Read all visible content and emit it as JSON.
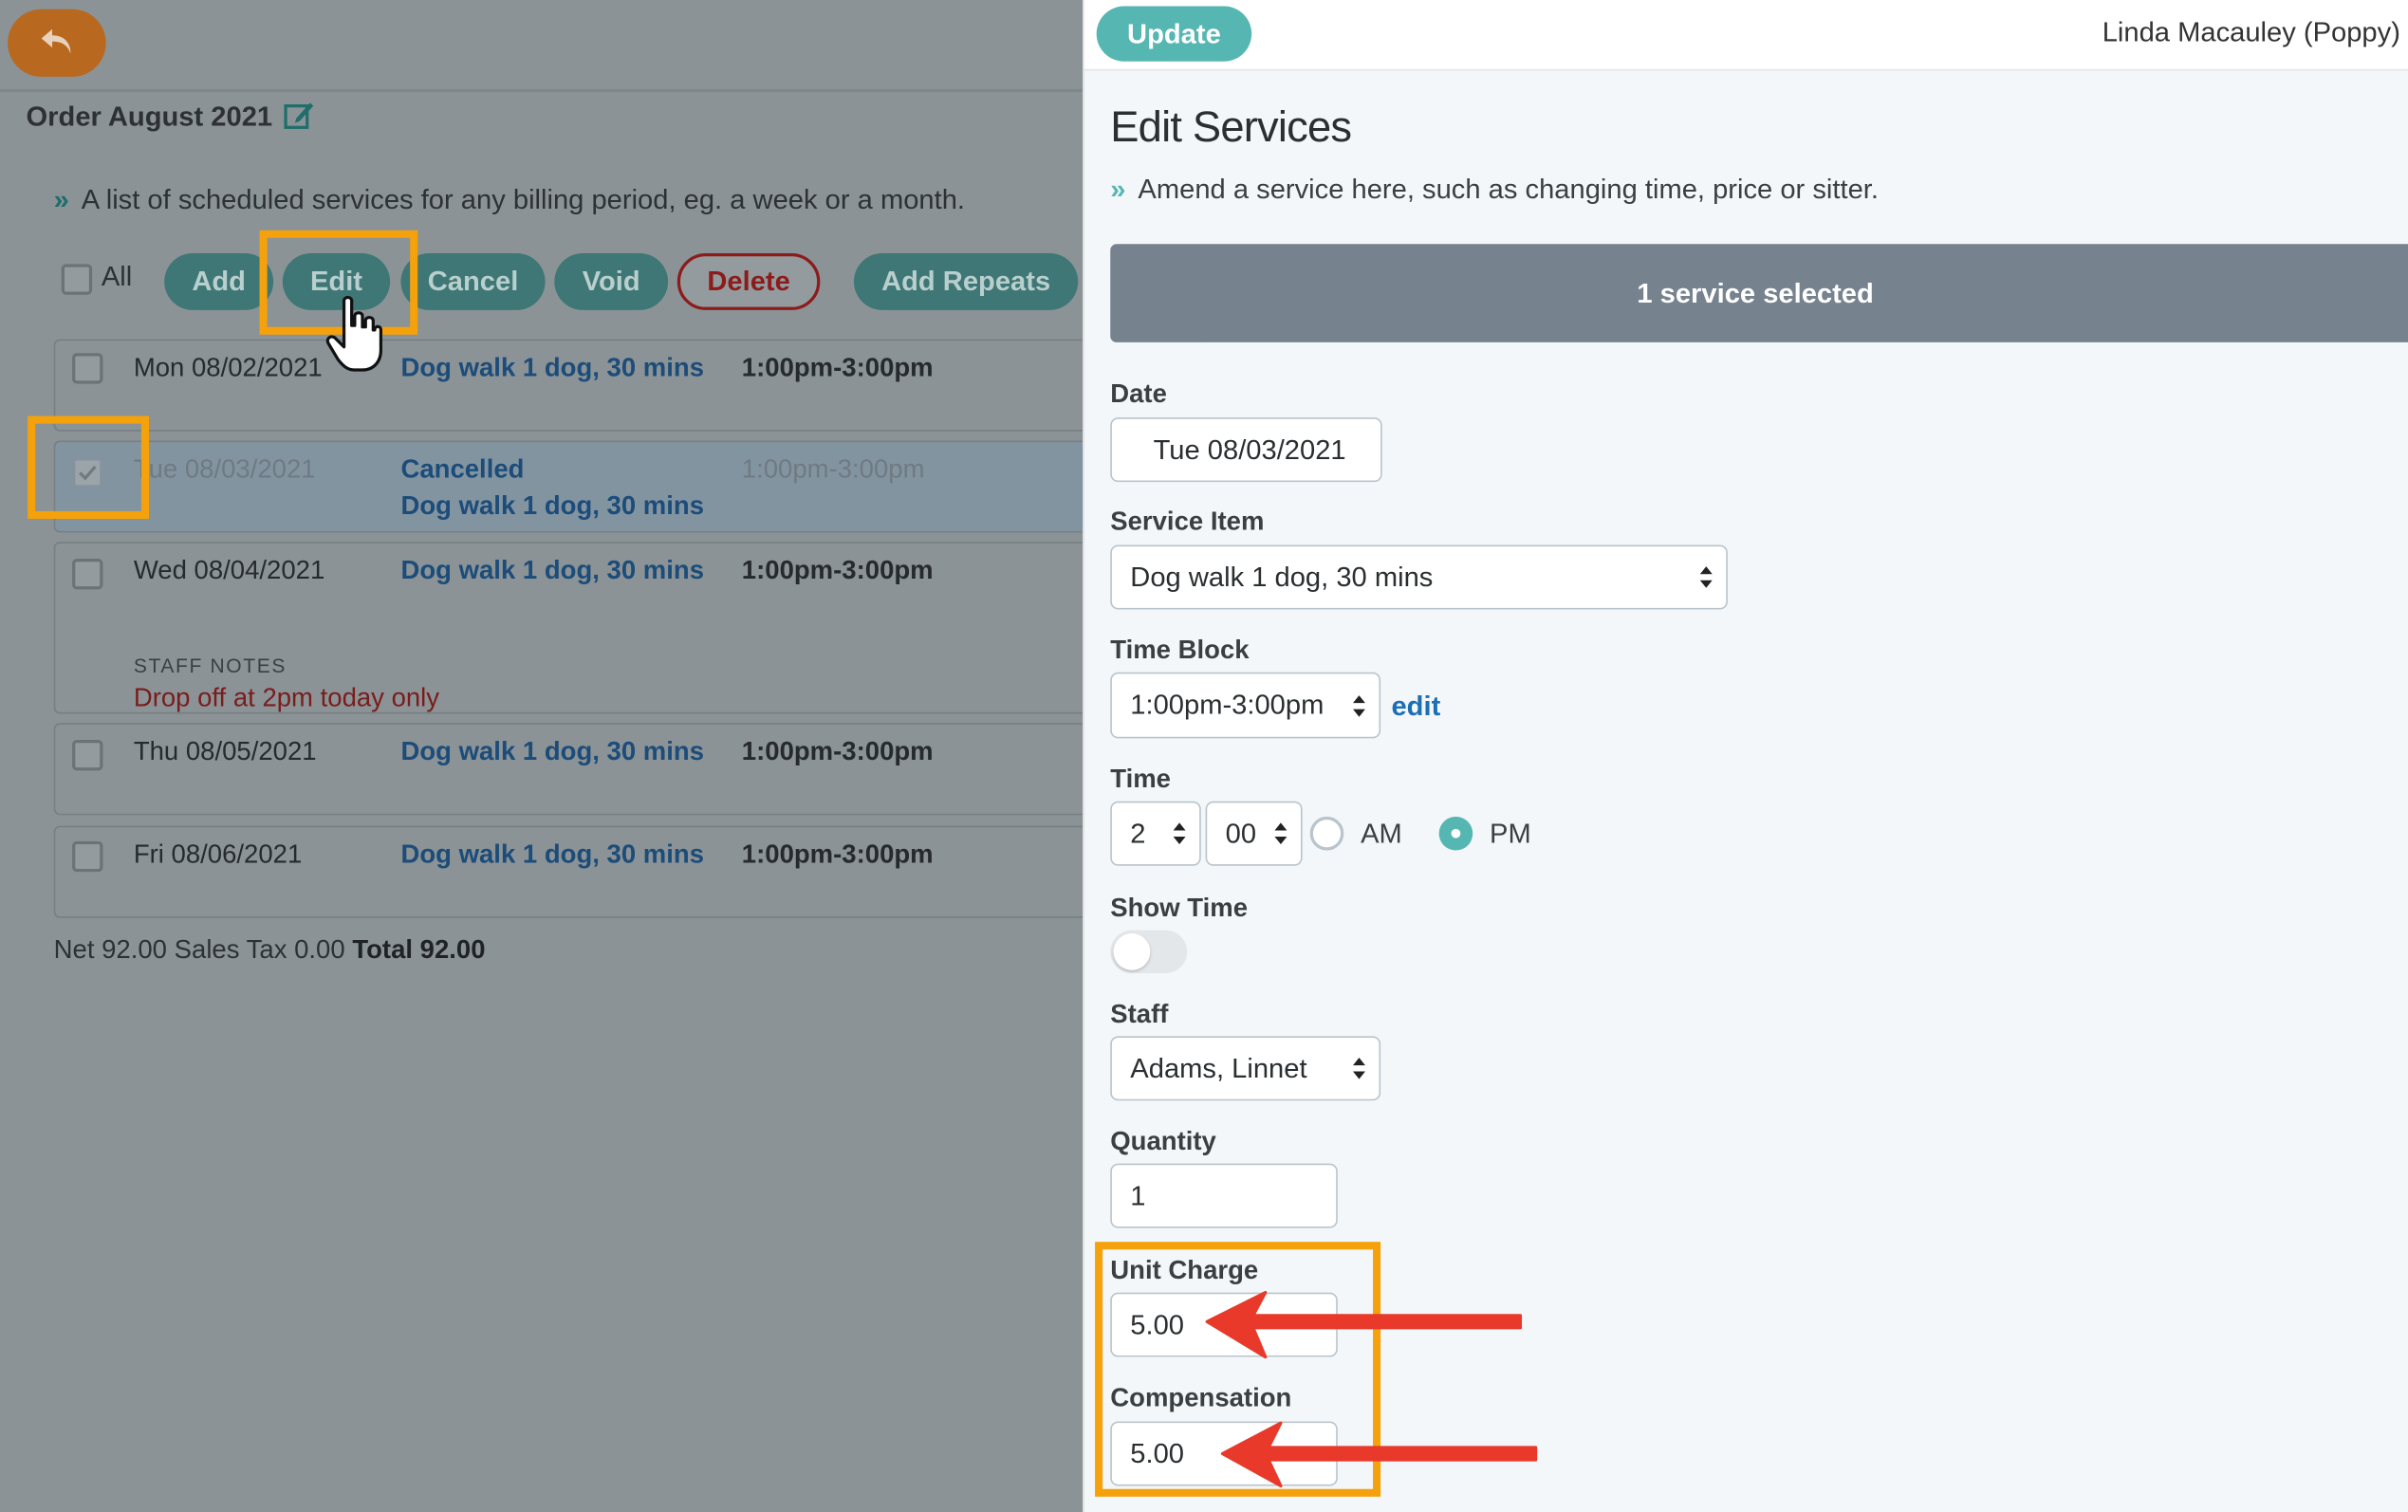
{
  "left": {
    "order_title": "Order August 2021",
    "intro": "A list of scheduled services for any billing period, eg. a week or a month.",
    "all_label": "All",
    "buttons": {
      "add": "Add",
      "edit": "Edit",
      "cancel": "Cancel",
      "void": "Void",
      "delete": "Delete",
      "add_repeats": "Add Repeats"
    },
    "rows": [
      {
        "date": "Mon 08/02/2021",
        "service": "Dog walk 1 dog, 30 mins",
        "time": "1:00pm-3:00pm"
      },
      {
        "date": "Tue 08/03/2021",
        "status": "Cancelled",
        "service": "Dog walk 1 dog, 30 mins",
        "time": "1:00pm-3:00pm",
        "checked": true
      },
      {
        "date": "Wed 08/04/2021",
        "service": "Dog walk 1 dog, 30 mins",
        "time": "1:00pm-3:00pm",
        "notes_heading": "STAFF NOTES",
        "notes": "Drop off at 2pm today only"
      },
      {
        "date": "Thu 08/05/2021",
        "service": "Dog walk 1 dog, 30 mins",
        "time": "1:00pm-3:00pm"
      },
      {
        "date": "Fri 08/06/2021",
        "service": "Dog walk 1 dog, 30 mins",
        "time": "1:00pm-3:00pm"
      }
    ],
    "totals": {
      "net": "Net 92.00",
      "tax": "Sales Tax 0.00",
      "total": "Total 92.00"
    }
  },
  "modal": {
    "update_label": "Update",
    "client_name": "Linda Macauley (Poppy)",
    "title": "Edit Services",
    "subtitle": "Amend a service here, such as changing time, price or sitter.",
    "banner": "1 service selected",
    "date_label": "Date",
    "date_value": "Tue 08/03/2021",
    "service_item_label": "Service Item",
    "service_item_value": "Dog walk 1 dog, 30 mins",
    "time_block_label": "Time Block",
    "time_block_value": "1:00pm-3:00pm",
    "time_block_edit": "edit",
    "time_label": "Time",
    "time_hour": "2",
    "time_minute": "00",
    "am_label": "AM",
    "pm_label": "PM",
    "meridiem_selected": "PM",
    "show_time_label": "Show Time",
    "show_time_on": false,
    "staff_label": "Staff",
    "staff_value": "Adams, Linnet",
    "quantity_label": "Quantity",
    "quantity_value": "1",
    "unit_charge_label": "Unit Charge",
    "unit_charge_value": "5.00",
    "compensation_label": "Compensation",
    "compensation_value": "5.00"
  },
  "colors": {
    "accent": "#56b7b2",
    "highlight": "#f5a10b",
    "arrow": "#e8392a",
    "link": "#1d6fb5"
  },
  "icons": [
    "undo-arrow-icon",
    "edit-note-icon",
    "double-chevron-icon",
    "spinner-arrows-icon",
    "pointer-hand-icon",
    "red-arrow-icon"
  ]
}
